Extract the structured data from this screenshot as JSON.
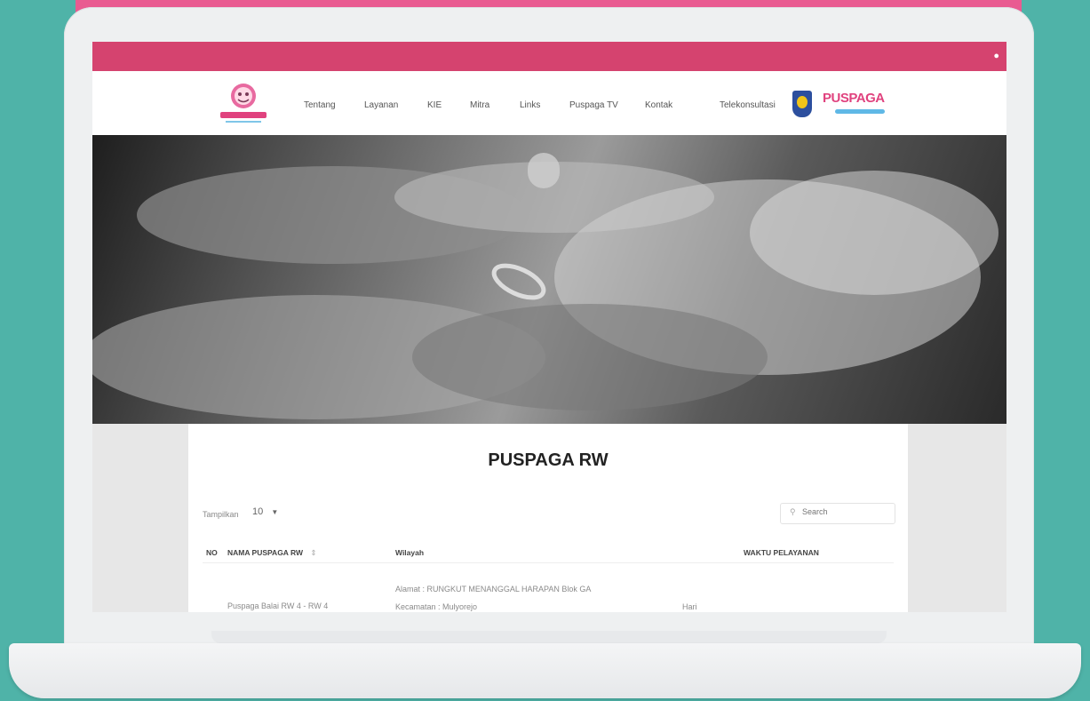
{
  "site": {
    "nav": [
      "Tentang",
      "Layanan",
      "KIE",
      "Mitra",
      "Links",
      "Puspaga TV",
      "Kontak",
      "Telekonsultasi"
    ],
    "brand": "PUSPAGA"
  },
  "page": {
    "title": "PUSPAGA RW",
    "length_label": "Tampilkan",
    "length_value": "10",
    "search_placeholder": "Search"
  },
  "table": {
    "headers": [
      "NO",
      "NAMA PUSPAGA RW",
      "Wilayah",
      "WAKTU PELAYANAN"
    ],
    "rows": [
      {
        "name": "Puspaga Balai RW 4 - RW 4",
        "address": "Alamat : RUNGKUT MENANGGAL HARAPAN Blok GA",
        "district": "Kecamatan : Mulyorejo",
        "time": "Hari"
      }
    ]
  },
  "colors": {
    "background": "#4fb3a8",
    "topbar": "#d5436f",
    "accent": "#e95b91"
  }
}
